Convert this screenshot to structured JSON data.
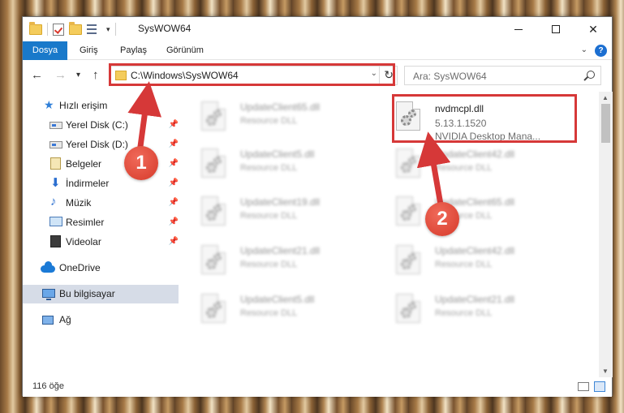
{
  "window": {
    "title": "SysWOW64",
    "qat_dropdown": "▾",
    "minimize_label": "",
    "maximize_label": "",
    "close_label": "✕"
  },
  "ribbon": {
    "tabs": [
      "Dosya",
      "Giriş",
      "Paylaş",
      "Görünüm"
    ],
    "chevron": "⌄",
    "help": "?"
  },
  "nav": {
    "back": "←",
    "forward": "→",
    "recent": "▾",
    "up": "↑",
    "address": "C:\\Windows\\SysWOW64",
    "address_dropdown": "⌄",
    "refresh": "↻",
    "search_placeholder": "Ara: SysWOW64"
  },
  "sidebar": {
    "items": [
      {
        "label": "Hızlı erişim",
        "icon": "star-icon",
        "pinned": false
      },
      {
        "label": "Yerel Disk (C:)",
        "icon": "disk-icon",
        "pinned": true
      },
      {
        "label": "Yerel Disk (D:)",
        "icon": "disk-icon",
        "pinned": true
      },
      {
        "label": "Belgeler",
        "icon": "documents-icon",
        "pinned": true
      },
      {
        "label": "İndirmeler",
        "icon": "downloads-icon",
        "pinned": true
      },
      {
        "label": "Müzik",
        "icon": "music-icon",
        "pinned": true
      },
      {
        "label": "Resimler",
        "icon": "pictures-icon",
        "pinned": true
      },
      {
        "label": "Videolar",
        "icon": "videos-icon",
        "pinned": true
      },
      {
        "label": "OneDrive",
        "icon": "onedrive-icon",
        "pinned": false
      },
      {
        "label": "Bu bilgisayar",
        "icon": "this-pc-icon",
        "pinned": false,
        "selected": true
      },
      {
        "label": "Ağ",
        "icon": "network-icon",
        "pinned": false
      }
    ],
    "pin_glyph": "📌"
  },
  "files": {
    "left_column": [
      {
        "name": "UpdateClient65.dll",
        "type": "Resource DLL"
      },
      {
        "name": "UpdateClient5.dll",
        "type": "Resource DLL"
      },
      {
        "name": "UpdateClient19.dll",
        "type": "Resource DLL"
      },
      {
        "name": "UpdateClient21.dll",
        "type": "Resource DLL"
      },
      {
        "name": "UpdateClient5.dll",
        "type": "Resource DLL"
      }
    ],
    "right_column": [
      {
        "name": "nvdmcpl.dll",
        "version": "5.13.1.1520",
        "type": "NVIDIA Desktop Mana...",
        "highlighted": true
      },
      {
        "name": "UpdateClient42.dll",
        "type": "Resource DLL"
      },
      {
        "name": "UpdateClient65.dll",
        "type": "Resource DLL"
      },
      {
        "name": "UpdateClient42.dll",
        "type": "Resource DLL"
      },
      {
        "name": "UpdateClient21.dll",
        "type": "Resource DLL"
      }
    ]
  },
  "status": {
    "item_count": "116 öğe"
  },
  "annotations": {
    "marker_1": "1",
    "marker_2": "2",
    "color": "#d63838"
  },
  "colors": {
    "accent": "#1979ca",
    "selection": "#d6dce7",
    "annotation": "#d63838"
  }
}
